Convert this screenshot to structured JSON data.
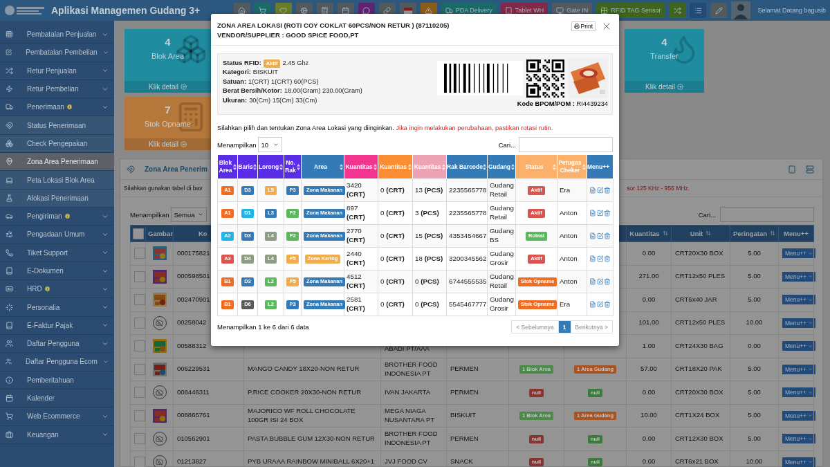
{
  "topbar": {
    "title": "Aplikasi Managemen Gudang 3+",
    "greeting": "Selamat Datang bagusib",
    "buttons": [
      {
        "kind": "home",
        "color": "#52595f"
      },
      {
        "kind": "cart",
        "color": "#196a68"
      },
      {
        "kind": "heart",
        "color": "#697c28"
      },
      {
        "kind": "gears",
        "color": "#52595f"
      },
      {
        "kind": "calculator",
        "color": "#52595f"
      },
      {
        "kind": "calendar",
        "color": "#52595f"
      },
      {
        "kind": "chat",
        "color": "#5f2371"
      },
      {
        "kind": "link",
        "color": "#52595f"
      },
      {
        "kind": "flag",
        "color": "#52595f"
      },
      {
        "kind": "warning",
        "color": "#8b5d1c"
      },
      {
        "kind": "truck",
        "color": "#196a68",
        "label": "PDA Delivery"
      },
      {
        "kind": "tablet",
        "color": "#82284a",
        "label": "Tablet WH"
      },
      {
        "kind": "monitor",
        "color": "#52595f",
        "label": "Gate IN"
      },
      {
        "kind": "grid",
        "color": "#3e641f",
        "label": "RFID TAG Sensor"
      },
      {
        "kind": "shuffle",
        "color": "#3e641f"
      },
      {
        "kind": "list",
        "color": "#224a79"
      },
      {
        "kind": "pencil",
        "color": "#52595f"
      }
    ]
  },
  "sidebar": {
    "items": [
      {
        "label": "Pembatalan Penjualan",
        "alert": false,
        "submenu": true,
        "selected": false
      },
      {
        "label": "Pembatalan Pembelian",
        "alert": false,
        "submenu": true,
        "selected": false
      },
      {
        "label": "Retur Penjualan",
        "alert": false,
        "submenu": true,
        "selected": false
      },
      {
        "label": "Retur Pembelian",
        "alert": false,
        "submenu": true,
        "selected": false
      },
      {
        "label": "Penerimaan",
        "alert": true,
        "submenu": true,
        "selected": false,
        "children": [
          {
            "label": "Status Penerimaan",
            "selected": false
          },
          {
            "label": "Check Pengepakan",
            "selected": false
          },
          {
            "label": "Zona Area Penerimaan",
            "selected": true
          },
          {
            "label": "Peta Lokasi Blok Area",
            "selected": false
          },
          {
            "label": "Alokasi Penerimaan",
            "selected": false
          }
        ]
      },
      {
        "label": "Pengiriman",
        "alert": true,
        "submenu": true,
        "selected": false
      },
      {
        "label": "Pengadaan Umum",
        "alert": false,
        "submenu": true,
        "selected": false
      },
      {
        "label": "Tiket Support",
        "alert": false,
        "submenu": true,
        "selected": false
      },
      {
        "label": "E-Dokumen",
        "alert": false,
        "submenu": true,
        "selected": false
      },
      {
        "label": "HRD",
        "alert": true,
        "submenu": true,
        "selected": false
      },
      {
        "label": "Personalia",
        "alert": false,
        "submenu": true,
        "selected": false
      },
      {
        "label": "E-Faktur Pajak",
        "alert": false,
        "submenu": true,
        "selected": false
      },
      {
        "label": "Daftar Pengguna",
        "alert": false,
        "submenu": true,
        "selected": false
      },
      {
        "label": "Daftar Pengguna Ecom",
        "alert": false,
        "submenu": true,
        "selected": false
      },
      {
        "label": "Pemberitahuan",
        "alert": false,
        "submenu": false,
        "selected": false
      },
      {
        "label": "Kalender",
        "alert": false,
        "submenu": false,
        "selected": false
      },
      {
        "label": "Web Ecommerce",
        "alert": false,
        "submenu": true,
        "selected": false
      },
      {
        "label": "Keuangan",
        "alert": false,
        "submenu": true,
        "selected": false
      }
    ]
  },
  "card_rows": [
    [
      {
        "value": "4",
        "label": "Blok Area",
        "link": "Klik detail",
        "color": "#1f8ca0"
      },
      {
        "value": "4",
        "label": "Transfer",
        "link": "Klik detail",
        "color": "#1f8ca0"
      }
    ],
    [
      {
        "value": "7",
        "label": "Stok Opname",
        "link": "Klik detail",
        "color": "#b5773a"
      }
    ]
  ],
  "panel": {
    "title": "Zona Area Penerim",
    "note": "Silahkan gunakan tabel di bav",
    "note_warning": "sor 125 KHz - 956 MHz.",
    "length_label": "Menampilkan",
    "length_value": "Semua",
    "search_label": "Cari...",
    "columns": [
      {
        "kind": "check",
        "checked": false
      },
      {
        "label": "Gambar",
        "kind": "text"
      },
      {
        "label": "Ko",
        "kind": "cut"
      },
      {
        "kind": "blank"
      },
      {
        "kind": "blank"
      },
      {
        "kind": "blank"
      },
      {
        "kind": "blank"
      },
      {
        "kind": "blank"
      },
      {
        "label": "Kuantitas",
        "kind": "sort"
      },
      {
        "label": "Unit",
        "kind": "sort"
      },
      {
        "label": "Peringatan",
        "kind": "sort"
      },
      {
        "label": "Menu++",
        "kind": "text"
      }
    ],
    "rows": [
      {
        "kind": "picture",
        "checked": false,
        "code": "000175821",
        "qty": "0.00",
        "unit": "CRT20X30 BOX",
        "warn": "5.00",
        "menu": "Menu++"
      },
      {
        "kind": "picture",
        "checked": false,
        "code": "000598501",
        "qty": "271.00",
        "unit": "CRT12x50 PLES",
        "warn": "5.00",
        "menu": "Menu++"
      },
      {
        "kind": "picture",
        "checked": false,
        "code": "002470901",
        "qty": "0.00",
        "unit": "CRT6x40 JAR",
        "warn": "5.00",
        "menu": "Menu++"
      },
      {
        "kind": "none",
        "checked": false,
        "code": "00258042",
        "qty": "101.00",
        "unit": "CRT12x50 PLES",
        "warn": "10.00",
        "menu": "Menu++"
      },
      {
        "kind": "picture",
        "checked": false,
        "code": "00588312",
        "vendor": "ABADI PT/AAA",
        "qty": "1.00",
        "unit": "CRT24X30 BAG",
        "warn": "0.00",
        "menu": "Menu++"
      },
      {
        "kind": "picture",
        "checked": false,
        "code": "006229531",
        "name": "MANGO CANDY 18X20-NON RETUR",
        "vendor": "BROTHER FOOD INDONESIA PT",
        "category": "PERMEN",
        "blok": {
          "text": "1 Blok Area",
          "color": "#4c8a4a"
        },
        "area": {
          "text": "1 Area Gudang",
          "color": "#a65424"
        },
        "qty": "57.00",
        "unit": "CRT18X20 PAK",
        "warn": "5.00",
        "menu": "Menu++"
      },
      {
        "kind": "none",
        "checked": false,
        "code": "008446311",
        "name": "P.RICE COOKER 20X30-NON RETUR",
        "vendor": "IVAN JAKARTA",
        "category": "PERMEN",
        "blok": {
          "text": "null",
          "color": "#8a3431"
        },
        "area": {
          "text": "null",
          "color": "#3c7a3c"
        },
        "qty": "0.00",
        "unit": "CRT20X30 BOX",
        "warn": "5.00",
        "menu": "Menu++"
      },
      {
        "kind": "picture",
        "checked": false,
        "code": "008865761",
        "name": "MAJORICO WF ROLL CHOCOLATE 100GR ISI 24 BOX",
        "vendor": "MEGA NIAGA NUSANTARA PT",
        "category": "BISKUIT",
        "blok": {
          "text": "1 Blok Area",
          "color": "#4c8a4a"
        },
        "area": {
          "text": "1 Area Gudang",
          "color": "#a65424"
        },
        "qty": "10.00",
        "unit": "CRT1X24 BOX",
        "warn": "5.00",
        "menu": "Menu++"
      },
      {
        "kind": "none",
        "checked": false,
        "code": "010562901",
        "name": "PASTA BUBBLE GUM 12X30-NON RETUR",
        "vendor": "BROTHER FOOD INDONESIA PT",
        "category": "PERMEN",
        "blok": {
          "text": "null",
          "color": "#8a3431"
        },
        "area": {
          "text": "null",
          "color": "#3c7a3c"
        },
        "qty": "0.00",
        "unit": "CRT12X30 BOX",
        "warn": "5.00",
        "menu": "Menu++"
      },
      {
        "kind": "none",
        "checked": false,
        "code": "01213827",
        "name": "PYB URAAA RAINBOW MINIBALL 6X20+1",
        "vendor": "JVJ FOOD CV",
        "category": "SNACK",
        "blok": {
          "text": "null",
          "color": "#8a3431"
        },
        "area": {
          "text": "null",
          "color": "#3c7a3c"
        },
        "qty": "0.00",
        "unit": "CRT6x21 BOX",
        "warn": "10.00",
        "menu": "Menu++"
      }
    ]
  },
  "modal": {
    "title": "ZONA AREA LOKASI (ROTI COY COKLAT 60PCS/NON RETUR ) (87110205)",
    "subtitle": "VENDOR/SUPPLIER : GOOD SPICE FOOD,PT",
    "print": "Print",
    "info": [
      {
        "label": "Status RFID:",
        "badge": "Aktif",
        "value": "2.45 Ghz"
      },
      {
        "label": "Kategori:",
        "value": "BISKUIT"
      },
      {
        "label": "Satuan:",
        "value": "1(CRT) 1(CRT) 60(PCS)"
      },
      {
        "label": "Berat Bersih/Kotor:",
        "value": "18.00(Gram) 230.00(Gram)"
      },
      {
        "label": "Ukuran:",
        "value": "30(Cm) 15(Cm) 33(Cm)"
      }
    ],
    "bpom_label": "Kode BPOM/POM :",
    "bpom_value": "RI4439234",
    "instruction": "Silahkan pilih dan tentukan Zona Area Lokasi yang diinginkan.",
    "instruction_warning": "Jika ingin melakukan perubahaan, pastikan rotasi rutin.",
    "length_label": "Menampilkan",
    "length_value": "10",
    "search_label": "Cari...",
    "table": {
      "columns": [
        {
          "label": "Blok Area",
          "color": "#5b2de6",
          "sortable": true
        },
        {
          "label": "Baris",
          "color": "#5b2de6",
          "sortable": true
        },
        {
          "label": "Lorong",
          "color": "#5b2de6",
          "sortable": true
        },
        {
          "label": "No. Rak",
          "color": "#5b2de6",
          "sortable": true
        },
        {
          "label": "Area",
          "color": "#337ab7",
          "sortable": true
        },
        {
          "label": "Kuantitas",
          "color": "#f2358f",
          "sortable": true
        },
        {
          "label": "Kuantitas",
          "color": "#fd8d33",
          "sortable": true
        },
        {
          "label": "Kuantitas",
          "color": "#eda3b3",
          "sortable": true
        },
        {
          "label": "Rak Barcode",
          "color": "#337ab7",
          "sortable": true
        },
        {
          "label": "Gudang",
          "color": "#337ab7",
          "sortable": true
        },
        {
          "label": "Status",
          "color": "#fbb06c",
          "sortable": true
        },
        {
          "label": "Petugas Cheker",
          "color": "#fbb06c",
          "sortable": true
        },
        {
          "label": "Menu++",
          "color": "#337ab7",
          "sortable": false
        }
      ],
      "rows": [
        {
          "blok": {
            "text": "A1",
            "color": "#f26b22"
          },
          "baris": {
            "text": "D3",
            "color": "#337ab7"
          },
          "lorong": {
            "text": "L5",
            "color": "#f0ad4e"
          },
          "rak": {
            "text": "P3",
            "color": "#337ab7"
          },
          "area": {
            "text": "Zona Makanan",
            "color": "#337ab7"
          },
          "qty_1": "3420 **(CRT)**",
          "qty_2": "0 **(CRT)**",
          "qty_3": "13 **(PCS)**",
          "barcode": "2235565778",
          "gudang": "Gudang Retail",
          "status": {
            "text": "Aktif",
            "color": "#d9534f"
          },
          "petugas": "Era"
        },
        {
          "blok": {
            "text": "A1",
            "color": "#f26b22"
          },
          "baris": {
            "text": "D1",
            "color": "#1fb5e6"
          },
          "lorong": {
            "text": "L3",
            "color": "#337ab7"
          },
          "rak": {
            "text": "P2",
            "color": "#5cb85c"
          },
          "area": {
            "text": "Zona Makanan",
            "color": "#337ab7"
          },
          "qty_1": "897 **(CRT)**",
          "qty_2": "0 **(CRT)**",
          "qty_3": "3 **(PCS)**",
          "barcode": "2235565778",
          "gudang": "Gudang Retail",
          "status": {
            "text": "Aktif",
            "color": "#d9534f"
          },
          "petugas": "Anton"
        },
        {
          "blok": {
            "text": "A2",
            "color": "#1fb5e6"
          },
          "baris": {
            "text": "D3",
            "color": "#337ab7"
          },
          "lorong": {
            "text": "L4",
            "color": "#8d9c82"
          },
          "rak": {
            "text": "P2",
            "color": "#5cb85c"
          },
          "area": {
            "text": "Zona Makanan",
            "color": "#337ab7"
          },
          "qty_1": "2770 **(CRT)**",
          "qty_2": "0 **(CRT)**",
          "qty_3": "15 **(PCS)**",
          "barcode": "4353454667",
          "gudang": "Gudang BS",
          "status": {
            "text": "Rotasi",
            "color": "#5cb85c"
          },
          "petugas": "Anton"
        },
        {
          "blok": {
            "text": "A3",
            "color": "#d9534f"
          },
          "baris": {
            "text": "D4",
            "color": "#8d9c82"
          },
          "lorong": {
            "text": "L4",
            "color": "#8d9c82"
          },
          "rak": {
            "text": "P5",
            "color": "#f0ad4e"
          },
          "area": {
            "text": "Zona Kering",
            "color": "#f0ad4e"
          },
          "qty_1": "2440 **(CRT)**",
          "qty_2": "0 **(CRT)**",
          "qty_3": "18 **(PCS)**",
          "barcode": "3200345562",
          "gudang": "Gudang Grosir",
          "status": {
            "text": "Aktif",
            "color": "#d9534f"
          },
          "petugas": "Anton"
        },
        {
          "blok": {
            "text": "B1",
            "color": "#f26b22"
          },
          "baris": {
            "text": "D3",
            "color": "#337ab7"
          },
          "lorong": {
            "text": "L2",
            "color": "#5cb85c"
          },
          "rak": {
            "text": "P5",
            "color": "#f0ad4e"
          },
          "area": {
            "text": "Zona Makanan",
            "color": "#337ab7"
          },
          "qty_1": "4512 **(CRT)**",
          "qty_2": "0 **(CRT)**",
          "qty_3": "0 **(PCS)**",
          "barcode": "6744555535",
          "gudang": "Gudang Retail",
          "status": {
            "text": "Stok Opname",
            "color": "#f26b22"
          },
          "petugas": "Anton"
        },
        {
          "blok": {
            "text": "B1",
            "color": "#f26b22"
          },
          "baris": {
            "text": "D6",
            "color": "#5a5a5a"
          },
          "lorong": {
            "text": "L2",
            "color": "#5cb85c"
          },
          "rak": {
            "text": "P3",
            "color": "#337ab7"
          },
          "area": {
            "text": "Zona Makanan",
            "color": "#337ab7"
          },
          "qty_1": "2581 **(CRT)**",
          "qty_2": "0 **(CRT)**",
          "qty_3": "0 **(PCS)**",
          "barcode": "5545467777",
          "gudang": "Gudang Grosir",
          "status": {
            "text": "Stok Opname",
            "color": "#f26b22"
          },
          "petugas": "Era"
        }
      ]
    },
    "summary": "Menampilkan 1 ke 6 dari 6 data",
    "pagination": [
      {
        "label": "< Sebelumnya",
        "selected": false,
        "disabled": true
      },
      {
        "label": "1",
        "selected": true,
        "disabled": false
      },
      {
        "label": "Berikutnya >",
        "selected": false,
        "disabled": true
      }
    ]
  }
}
